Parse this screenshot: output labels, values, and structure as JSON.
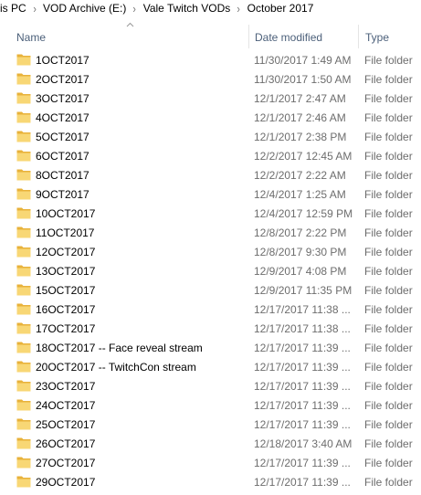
{
  "breadcrumb": [
    {
      "label": "is PC"
    },
    {
      "label": "VOD Archive (E:)"
    },
    {
      "label": "Vale Twitch VODs"
    },
    {
      "label": "October 2017"
    }
  ],
  "breadcrumb_separator": "›",
  "columns": {
    "name": "Name",
    "date_modified": "Date modified",
    "type": "Type"
  },
  "sort": {
    "column": "name",
    "indicator": "chevron-up-icon"
  },
  "folder_color": "#f8d775",
  "files": [
    {
      "name": "1OCT2017",
      "date": "11/30/2017 1:49 AM",
      "type": "File folder"
    },
    {
      "name": "2OCT2017",
      "date": "11/30/2017 1:50 AM",
      "type": "File folder"
    },
    {
      "name": "3OCT2017",
      "date": "12/1/2017 2:47 AM",
      "type": "File folder"
    },
    {
      "name": "4OCT2017",
      "date": "12/1/2017 2:46 AM",
      "type": "File folder"
    },
    {
      "name": "5OCT2017",
      "date": "12/1/2017 2:38 PM",
      "type": "File folder"
    },
    {
      "name": "6OCT2017",
      "date": "12/2/2017 12:45 AM",
      "type": "File folder"
    },
    {
      "name": "8OCT2017",
      "date": "12/2/2017 2:22 AM",
      "type": "File folder"
    },
    {
      "name": "9OCT2017",
      "date": "12/4/2017 1:25 AM",
      "type": "File folder"
    },
    {
      "name": "10OCT2017",
      "date": "12/4/2017 12:59 PM",
      "type": "File folder"
    },
    {
      "name": "11OCT2017",
      "date": "12/8/2017 2:22 PM",
      "type": "File folder"
    },
    {
      "name": "12OCT2017",
      "date": "12/8/2017 9:30 PM",
      "type": "File folder"
    },
    {
      "name": "13OCT2017",
      "date": "12/9/2017 4:08 PM",
      "type": "File folder"
    },
    {
      "name": "15OCT2017",
      "date": "12/9/2017 11:35 PM",
      "type": "File folder"
    },
    {
      "name": "16OCT2017",
      "date": "12/17/2017 11:38 ...",
      "type": "File folder"
    },
    {
      "name": "17OCT2017",
      "date": "12/17/2017 11:38 ...",
      "type": "File folder"
    },
    {
      "name": "18OCT2017 -- Face reveal stream",
      "date": "12/17/2017 11:39 ...",
      "type": "File folder"
    },
    {
      "name": "20OCT2017 -- TwitchCon stream",
      "date": "12/17/2017 11:39 ...",
      "type": "File folder"
    },
    {
      "name": "23OCT2017",
      "date": "12/17/2017 11:39 ...",
      "type": "File folder"
    },
    {
      "name": "24OCT2017",
      "date": "12/17/2017 11:39 ...",
      "type": "File folder"
    },
    {
      "name": "25OCT2017",
      "date": "12/17/2017 11:39 ...",
      "type": "File folder"
    },
    {
      "name": "26OCT2017",
      "date": "12/18/2017 3:40 AM",
      "type": "File folder"
    },
    {
      "name": "27OCT2017",
      "date": "12/17/2017 11:39 ...",
      "type": "File folder"
    },
    {
      "name": "29OCT2017",
      "date": "12/17/2017 11:39 ...",
      "type": "File folder"
    }
  ]
}
